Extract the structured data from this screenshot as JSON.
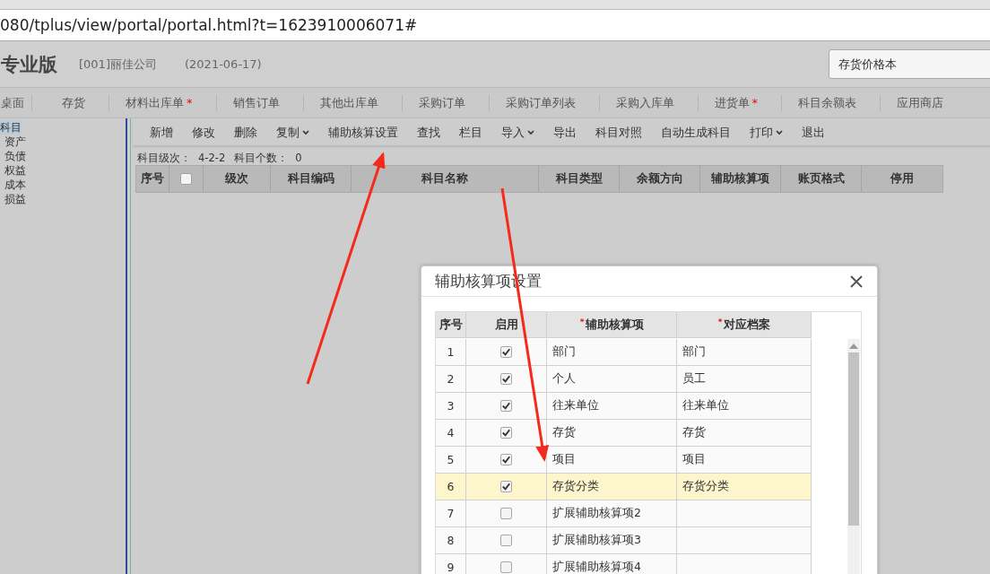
{
  "address_bar": {
    "url": "080/tplus/view/portal/portal.html?t=1623910006071#"
  },
  "header": {
    "product": "专业版",
    "company": "[001]丽佳公司",
    "date": "(2021-06-17)",
    "search": {
      "value": "存货价格本"
    }
  },
  "nav_tabs": [
    {
      "label": "桌面"
    },
    {
      "label": "存货"
    },
    {
      "label": "材料出库单",
      "mark": "*"
    },
    {
      "label": "销售订单"
    },
    {
      "label": "其他出库单"
    },
    {
      "label": "采购订单"
    },
    {
      "label": "采购订单列表"
    },
    {
      "label": "采购入库单"
    },
    {
      "label": "进货单",
      "mark": "*"
    },
    {
      "label": "科目余额表"
    },
    {
      "label": "应用商店"
    }
  ],
  "sidebar": {
    "items": [
      {
        "label": "科目",
        "selected": true,
        "children": [
          {
            "label": "资产",
            "selected": false
          },
          {
            "label": "负债",
            "selected": false
          },
          {
            "label": "权益",
            "selected": false
          },
          {
            "label": "成本",
            "selected": false
          },
          {
            "label": "损益",
            "selected": false
          }
        ]
      }
    ]
  },
  "toolbar": [
    {
      "label": "新增",
      "dropdown": false
    },
    {
      "label": "修改",
      "dropdown": false
    },
    {
      "label": "删除",
      "dropdown": false
    },
    {
      "label": "复制",
      "dropdown": true
    },
    {
      "label": "辅助核算设置",
      "dropdown": false
    },
    {
      "label": "查找",
      "dropdown": false
    },
    {
      "label": "栏目",
      "dropdown": false
    },
    {
      "label": "导入",
      "dropdown": true
    },
    {
      "label": "导出",
      "dropdown": false
    },
    {
      "label": "科目对照",
      "dropdown": false
    },
    {
      "label": "自动生成科目",
      "dropdown": false
    },
    {
      "label": "打印",
      "dropdown": true
    },
    {
      "label": "退出",
      "dropdown": false
    }
  ],
  "info": [
    {
      "label": "科目级次：",
      "value": "4-2-2"
    },
    {
      "label": "科目个数：",
      "value": "0"
    }
  ],
  "table": {
    "columns": [
      {
        "label": "序号",
        "kind": "text"
      },
      {
        "kind": "checkbox",
        "checked": false
      },
      {
        "label": "级次",
        "kind": "text"
      },
      {
        "label": "科目编码",
        "kind": "text"
      },
      {
        "label": "科目名称",
        "kind": "text"
      },
      {
        "label": "科目类型",
        "kind": "text"
      },
      {
        "label": "余额方向",
        "kind": "text"
      },
      {
        "label": "辅助核算项",
        "kind": "text"
      },
      {
        "label": "账页格式",
        "kind": "text"
      },
      {
        "label": "停用",
        "kind": "text"
      }
    ]
  },
  "dialog": {
    "title": "辅助核算项设置",
    "columns": [
      {
        "label": "序号"
      },
      {
        "label": "启用"
      },
      {
        "label": "辅助核算项",
        "mark": "*"
      },
      {
        "label": "对应档案",
        "mark": "*"
      }
    ],
    "rows": [
      {
        "no": "1",
        "enabled": true,
        "item": "部门",
        "archive": "部门",
        "selected": false
      },
      {
        "no": "2",
        "enabled": true,
        "item": "个人",
        "archive": "员工",
        "selected": false
      },
      {
        "no": "3",
        "enabled": true,
        "item": "往来单位",
        "archive": "往来单位",
        "selected": false
      },
      {
        "no": "4",
        "enabled": true,
        "item": "存货",
        "archive": "存货",
        "selected": false
      },
      {
        "no": "5",
        "enabled": true,
        "item": "项目",
        "archive": "项目",
        "selected": false
      },
      {
        "no": "6",
        "enabled": true,
        "item": "存货分类",
        "archive": "存货分类",
        "selected": true
      },
      {
        "no": "7",
        "enabled": false,
        "item": "扩展辅助核算项2",
        "selected": false
      },
      {
        "no": "8",
        "enabled": false,
        "item": "扩展辅助核算项3",
        "selected": false
      },
      {
        "no": "9",
        "enabled": false,
        "item": "扩展辅助核算项4",
        "selected": false
      }
    ]
  }
}
